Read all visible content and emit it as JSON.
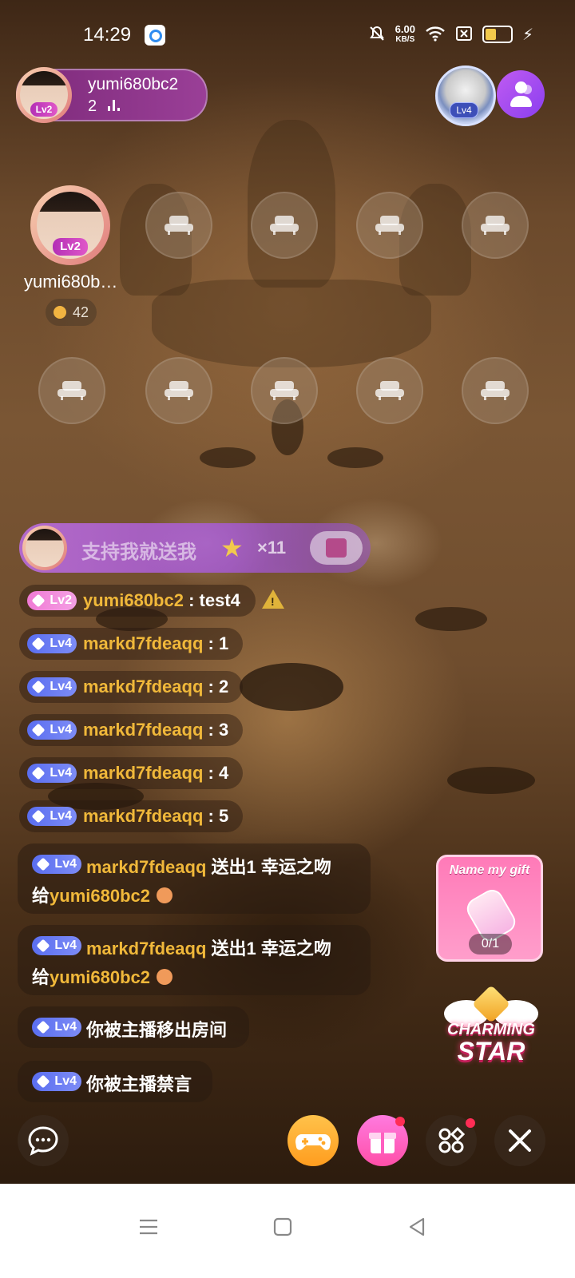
{
  "status_bar": {
    "time": "14:29",
    "speed_value": "6.00",
    "speed_unit": "KB/S"
  },
  "host": {
    "name": "yumi680bc2",
    "viewers": "2",
    "level": "Lv2"
  },
  "top_right": {
    "badge_level": "Lv4"
  },
  "host_seat": {
    "name": "yumi680b…",
    "level": "Lv2",
    "coins": "42"
  },
  "gift_banner": {
    "text": "支持我就送我",
    "multiplier": "×11"
  },
  "chat": [
    {
      "level": "Lv2",
      "user": "yumi680bc2",
      "message": "test4"
    },
    {
      "level": "Lv4",
      "user": "markd7fdeaqq",
      "message": "1"
    },
    {
      "level": "Lv4",
      "user": "markd7fdeaqq",
      "message": "2"
    },
    {
      "level": "Lv4",
      "user": "markd7fdeaqq",
      "message": "3"
    },
    {
      "level": "Lv4",
      "user": "markd7fdeaqq",
      "message": "4"
    },
    {
      "level": "Lv4",
      "user": "markd7fdeaqq",
      "message": "5"
    }
  ],
  "system_messages": [
    {
      "level": "Lv4",
      "user": "markd7fdeaqq",
      "action": "送出1 幸运之吻",
      "to_prefix": "给",
      "to_user": "yumi680bc2"
    },
    {
      "level": "Lv4",
      "user": "markd7fdeaqq",
      "action": "送出1 幸运之吻",
      "to_prefix": "给",
      "to_user": "yumi680bc2"
    },
    {
      "level": "Lv4",
      "text": "你被主播移出房间"
    },
    {
      "level": "Lv4",
      "text": "你被主播禁言"
    }
  ],
  "promos": {
    "name_gift_title": "Name my gift",
    "name_gift_counter": "0/1",
    "charming_line1": "CHARMING",
    "charming_line2": "STAR"
  },
  "separator": " : ",
  "colors": {
    "username": "#f0b83a",
    "host_pill": "#8e3589",
    "level_pink": "#f07ad4",
    "level_blue": "#5a6ef0",
    "game_button": "#ffb030",
    "gift_button": "#ff5fc0"
  },
  "icons": [
    "chat-bubble-icon",
    "gamepad-icon",
    "gift-icon",
    "apps-grid-icon",
    "close-icon",
    "sofa-seat-icon"
  ]
}
